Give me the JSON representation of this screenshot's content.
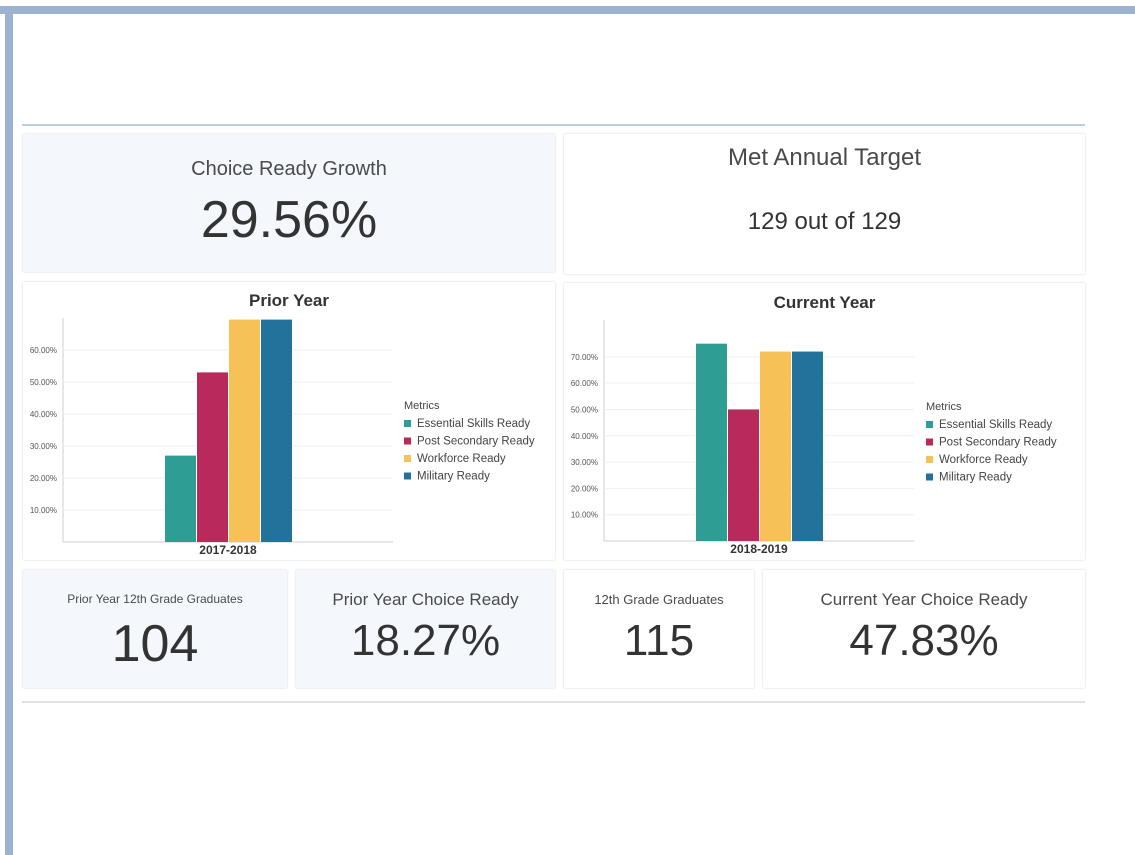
{
  "kpis": {
    "growth": {
      "label": "Choice Ready Growth",
      "value": "29.56%"
    },
    "target": {
      "label": "Met Annual Target",
      "value": "129 out of 129"
    }
  },
  "bottom": {
    "prior_grads": {
      "label": "Prior Year 12th Grade Graduates",
      "value": "104"
    },
    "prior_ready": {
      "label": "Prior Year Choice Ready",
      "value": "18.27%"
    },
    "current_grads": {
      "label": "12th Grade Graduates",
      "value": "115"
    },
    "current_ready": {
      "label": "Current Year Choice Ready",
      "value": "47.83%"
    }
  },
  "colors": {
    "essential": "#2e9e94",
    "post_secondary": "#b82a5c",
    "workforce": "#f6c257",
    "military": "#23729b"
  },
  "chart_data": [
    {
      "type": "bar",
      "title": "Prior Year",
      "categories": [
        "2017-2018"
      ],
      "yticks": [
        "10.00%",
        "20.00%",
        "30.00%",
        "40.00%",
        "50.00%",
        "60.00%"
      ],
      "ylim": [
        0,
        70
      ],
      "legend_title": "Metrics",
      "legend_position": "right",
      "series": [
        {
          "name": "Essential Skills Ready",
          "values": [
            27
          ]
        },
        {
          "name": "Post Secondary Ready",
          "values": [
            53
          ]
        },
        {
          "name": "Workforce Ready",
          "values": [
            69.5
          ]
        },
        {
          "name": "Military Ready",
          "values": [
            69.5
          ]
        }
      ]
    },
    {
      "type": "bar",
      "title": "Current Year",
      "categories": [
        "2018-2019"
      ],
      "yticks": [
        "10.00%",
        "20.00%",
        "30.00%",
        "40.00%",
        "50.00%",
        "60.00%",
        "70.00%"
      ],
      "ylim": [
        0,
        84
      ],
      "legend_title": "Metrics",
      "legend_position": "right",
      "series": [
        {
          "name": "Essential Skills Ready",
          "values": [
            75
          ]
        },
        {
          "name": "Post Secondary Ready",
          "values": [
            50
          ]
        },
        {
          "name": "Workforce Ready",
          "values": [
            72
          ]
        },
        {
          "name": "Military Ready",
          "values": [
            72
          ]
        }
      ]
    }
  ]
}
